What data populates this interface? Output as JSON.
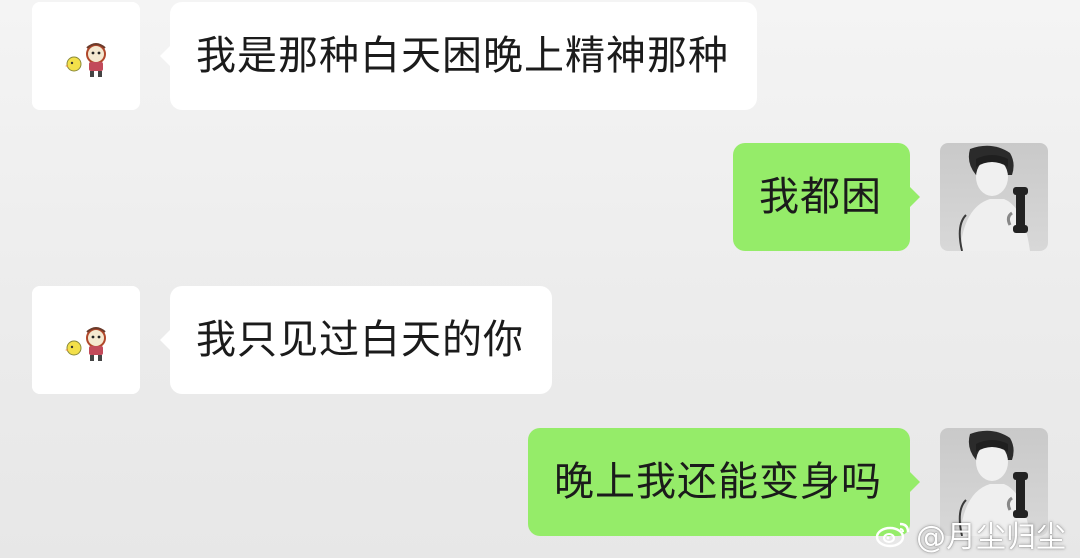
{
  "conversation": {
    "messages": [
      {
        "side": "left",
        "text": "我是那种白天困晚上精神那种"
      },
      {
        "side": "right",
        "text": "我都困"
      },
      {
        "side": "left",
        "text": "我只见过白天的你"
      },
      {
        "side": "right",
        "text": "晚上我还能变身吗"
      }
    ]
  },
  "colors": {
    "sent_bubble": "#95ec69",
    "received_bubble": "#ffffff",
    "background": "#ededed"
  },
  "watermark": {
    "text": "@月尘归尘",
    "icon": "weibo-icon"
  },
  "avatars": {
    "contact": "cartoon-chick-avatar",
    "self": "monochrome-photo-avatar-holding-phone"
  }
}
